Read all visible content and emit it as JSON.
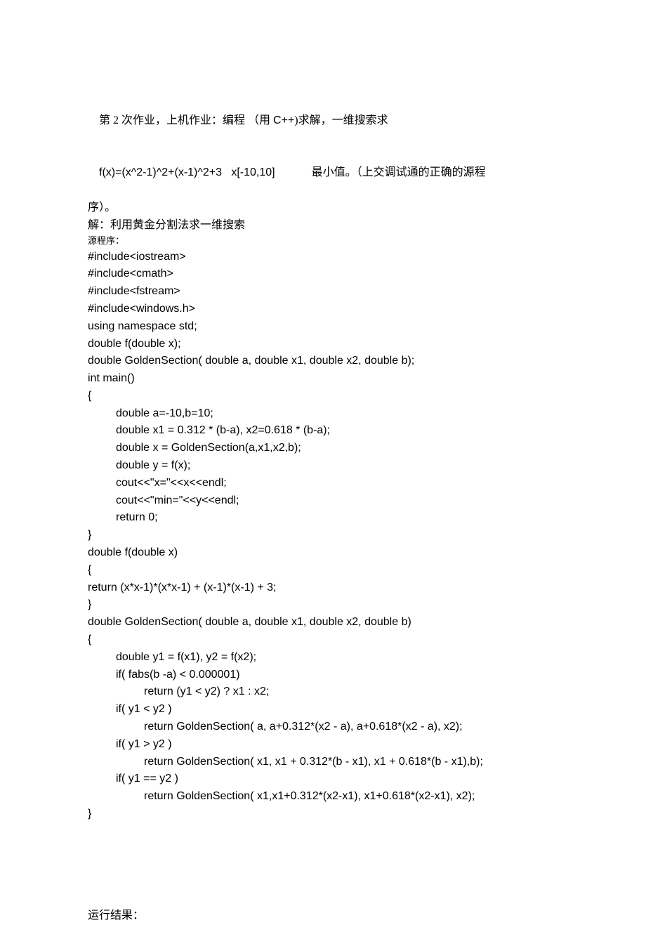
{
  "p1_a": "第 2 次作业，上机作业：编程 （用 ",
  "p1_b": "C++",
  "p1_c": ")求解，一维搜索求",
  "p2_a": "f(x)=(x^2-1)^2+(x-1)^2+3   x[-10,10]",
  "p2_b": "             最小值。（上交调试通的正确的源程",
  "p3": "序）。",
  "p4": "解：利用黄金分割法求一维搜索",
  "p5": "源程序：",
  "code": {
    "l0": "#include<iostream>",
    "l1": "#include<cmath>",
    "l2": "#include<fstream>",
    "l3": "#include<windows.h>",
    "l4": "using namespace std;",
    "l5": "double f(double x);",
    "l6": "double GoldenSection( double a, double x1, double x2, double b);",
    "l7": "int main()",
    "l8": "{",
    "l9": "double a=-10,b=10;",
    "l10": "double x1 = 0.312 * (b-a), x2=0.618 * (b-a);",
    "l11": "double x = GoldenSection(a,x1,x2,b);",
    "l12": "double y = f(x);",
    "l13": "cout<<\"x=\"<<x<<endl;",
    "l14": "cout<<\"min=\"<<y<<endl;",
    "l15": "return 0;",
    "l16": "}",
    "l17": "double f(double x)",
    "l18": "{",
    "l19": "return (x*x-1)*(x*x-1) + (x-1)*(x-1) + 3;",
    "l20": "}",
    "l21": "double GoldenSection( double a, double x1, double x2, double b)",
    "l22": "{",
    "l23": "double y1 = f(x1), y2 = f(x2);",
    "l24": "if( fabs(b -a) < 0.000001)",
    "l25": "return (y1 < y2) ? x1 : x2;",
    "l26": "if( y1 < y2 )",
    "l27": "return GoldenSection( a, a+0.312*(x2 - a), a+0.618*(x2 - a), x2);",
    "l28": "if( y1 > y2 )",
    "l29": "return GoldenSection( x1, x1 + 0.312*(b - x1), x1 + 0.618*(b - x1),b);",
    "l30": "if( y1 == y2 )",
    "l31": "return GoldenSection( x1,x1+0.312*(x2-x1), x1+0.618*(x2-x1), x2);",
    "l32": "}"
  },
  "p6": "运行结果："
}
